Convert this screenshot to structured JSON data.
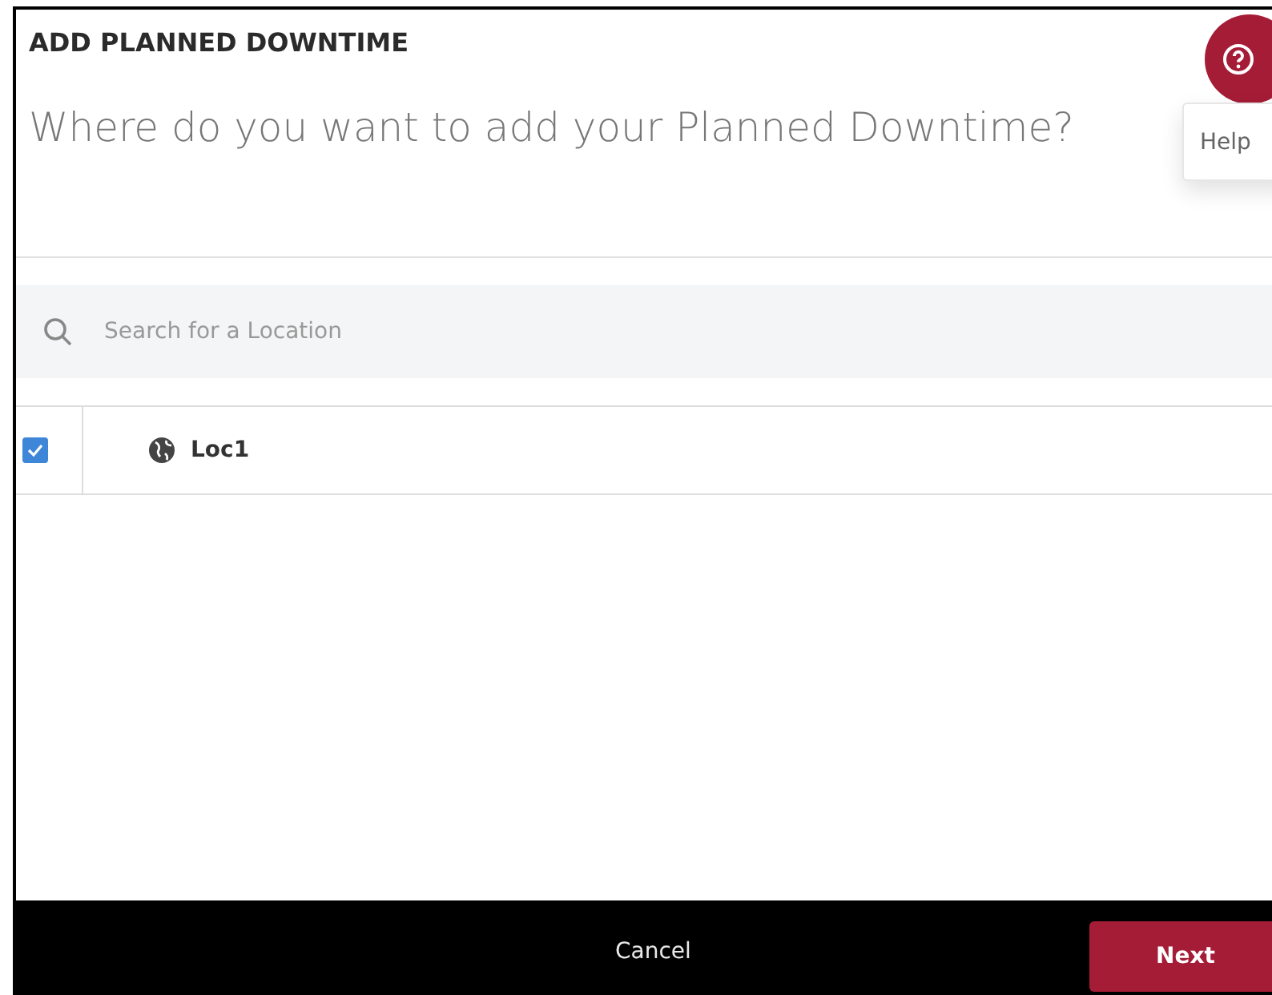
{
  "dialog": {
    "title": "ADD PLANNED DOWNTIME",
    "question": "Where do you want to add your Planned Downtime?"
  },
  "help": {
    "label": "Help"
  },
  "search": {
    "placeholder": "Search for a Location"
  },
  "locations": [
    {
      "name": "Loc1",
      "checked": true
    }
  ],
  "footer": {
    "cancel": "Cancel",
    "next": "Next"
  }
}
